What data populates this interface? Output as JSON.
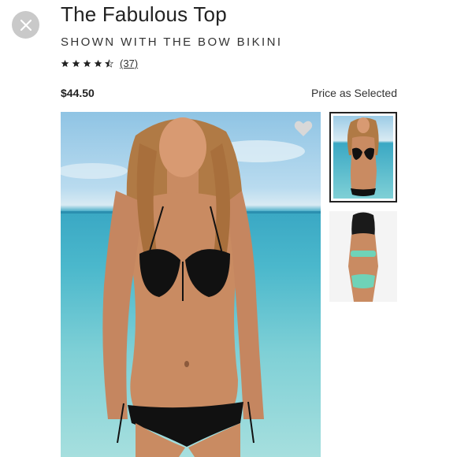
{
  "product": {
    "title": "The Fabulous Top",
    "subtitle": "SHOWN WITH THE BOW BIKINI",
    "rating": 4.5,
    "rating_max": 5,
    "review_count": "(37)",
    "price": "$44.50",
    "price_note": "Price as Selected"
  },
  "icons": {
    "close": "close-icon",
    "heart": "heart-icon",
    "star": "star-icon"
  },
  "colors": {
    "close_bg": "#c9c9c9",
    "heart": "#d8d8d8",
    "thumb_selected_border": "#222222"
  },
  "gallery": {
    "selected_index": 0,
    "thumbnails": [
      "front view black bikini",
      "back view mint bikini"
    ]
  }
}
